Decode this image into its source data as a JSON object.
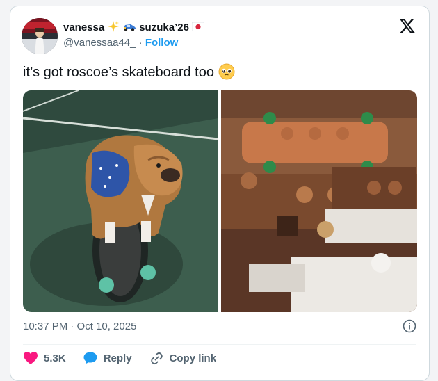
{
  "tweet": {
    "display_name_1": "vanessa",
    "display_name_2": "suzuka’26",
    "handle": "@vanessaa44_",
    "separator": "·",
    "follow_label": "Follow",
    "text": "it’s got roscoe’s skateboard too",
    "timestamp": "10:37 PM · Oct 10, 2025"
  },
  "actions": {
    "like_count": "5.3K",
    "reply_label": "Reply",
    "copy_label": "Copy link"
  },
  "colors": {
    "accent": "#1d9bf0",
    "like": "#f91880",
    "muted": "#536471"
  },
  "icons": [
    "sparkles-icon",
    "race-car-icon",
    "japan-flag-icon",
    "x-logo-icon",
    "pleading-face-icon",
    "info-icon",
    "heart-icon",
    "reply-icon",
    "link-icon"
  ]
}
